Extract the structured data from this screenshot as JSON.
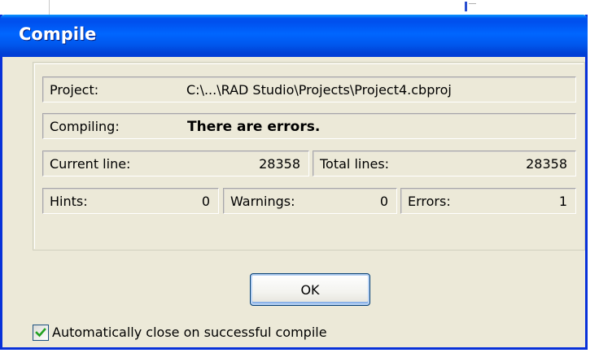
{
  "dialog": {
    "title": "Compile",
    "project": {
      "label": "Project:",
      "value": "C:\\...\\RAD Studio\\Projects\\Project4.cbproj"
    },
    "compiling": {
      "label": "Compiling:",
      "value": "There are errors."
    },
    "current_line": {
      "label": "Current line:",
      "value": "28358"
    },
    "total_lines": {
      "label": "Total lines:",
      "value": "28358"
    },
    "hints": {
      "label": "Hints:",
      "value": "0"
    },
    "warnings": {
      "label": "Warnings:",
      "value": "0"
    },
    "errors": {
      "label": "Errors:",
      "value": "1"
    },
    "ok_label": "OK",
    "auto_close": {
      "label": "Automatically close on successful compile",
      "checked": true
    }
  },
  "colors": {
    "titlebar": "#0058ee",
    "dialog_bg": "#ece9d8",
    "checkmark": "#21a121"
  }
}
